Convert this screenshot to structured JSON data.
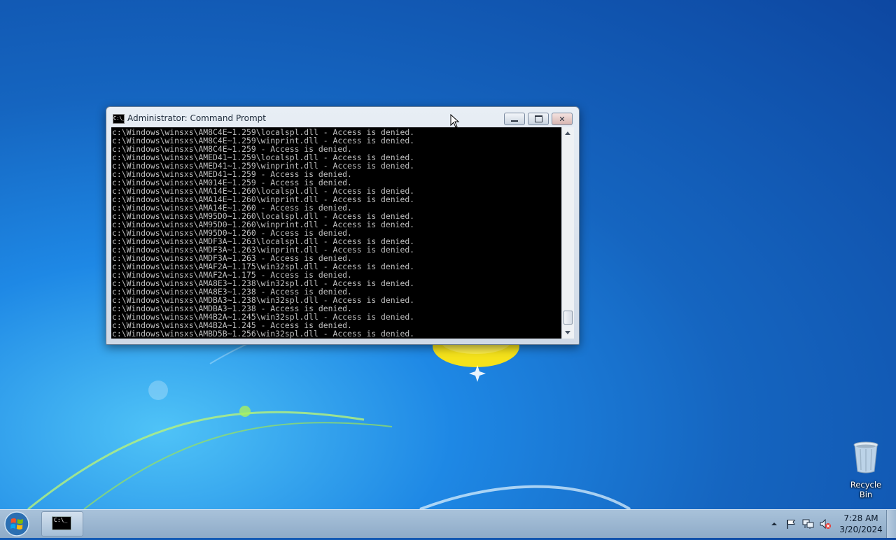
{
  "window": {
    "title": "Administrator:  Command Prompt",
    "icon_text": "C:\\_",
    "console_lines": [
      "c:\\Windows\\winsxs\\AM8C4E~1.259\\localspl.dll - Access is denied.",
      "c:\\Windows\\winsxs\\AM8C4E~1.259\\winprint.dll - Access is denied.",
      "c:\\Windows\\winsxs\\AM8C4E~1.259 - Access is denied.",
      "c:\\Windows\\winsxs\\AMED41~1.259\\localspl.dll - Access is denied.",
      "c:\\Windows\\winsxs\\AMED41~1.259\\winprint.dll - Access is denied.",
      "c:\\Windows\\winsxs\\AMED41~1.259 - Access is denied.",
      "c:\\Windows\\winsxs\\AM014E~1.259 - Access is denied.",
      "c:\\Windows\\winsxs\\AMA14E~1.260\\localspl.dll - Access is denied.",
      "c:\\Windows\\winsxs\\AMA14E~1.260\\winprint.dll - Access is denied.",
      "c:\\Windows\\winsxs\\AMA14E~1.260 - Access is denied.",
      "c:\\Windows\\winsxs\\AM95D0~1.260\\localspl.dll - Access is denied.",
      "c:\\Windows\\winsxs\\AM95D0~1.260\\winprint.dll - Access is denied.",
      "c:\\Windows\\winsxs\\AM95D0~1.260 - Access is denied.",
      "c:\\Windows\\winsxs\\AMDF3A~1.263\\localspl.dll - Access is denied.",
      "c:\\Windows\\winsxs\\AMDF3A~1.263\\winprint.dll - Access is denied.",
      "c:\\Windows\\winsxs\\AMDF3A~1.263 - Access is denied.",
      "c:\\Windows\\winsxs\\AMAF2A~1.175\\win32spl.dll - Access is denied.",
      "c:\\Windows\\winsxs\\AMAF2A~1.175 - Access is denied.",
      "c:\\Windows\\winsxs\\AMA8E3~1.238\\win32spl.dll - Access is denied.",
      "c:\\Windows\\winsxs\\AMA8E3~1.238 - Access is denied.",
      "c:\\Windows\\winsxs\\AMDBA3~1.238\\win32spl.dll - Access is denied.",
      "c:\\Windows\\winsxs\\AMDBA3~1.238 - Access is denied.",
      "c:\\Windows\\winsxs\\AM4B2A~1.245\\win32spl.dll - Access is denied.",
      "c:\\Windows\\winsxs\\AM4B2A~1.245 - Access is denied.",
      "c:\\Windows\\winsxs\\AMBD5B~1.256\\win32spl.dll - Access is denied."
    ]
  },
  "desktop": {
    "recycle_bin_label": "Recycle Bin"
  },
  "taskbar": {
    "cmd_icon_text": "C:\\_",
    "clock_time": "7:28 AM",
    "clock_date": "3/20/2024"
  },
  "colors": {
    "console_bg": "#000000",
    "console_text": "#c0c0c0",
    "taskbar": "#9db6cf"
  },
  "icons": [
    "cmd-icon",
    "minimize-icon",
    "maximize-icon",
    "close-icon",
    "recycle-bin-icon",
    "windows-start-icon",
    "chevron-up-icon",
    "action-center-flag-icon",
    "network-icon",
    "speaker-muted-icon",
    "mouse-cursor-icon"
  ]
}
